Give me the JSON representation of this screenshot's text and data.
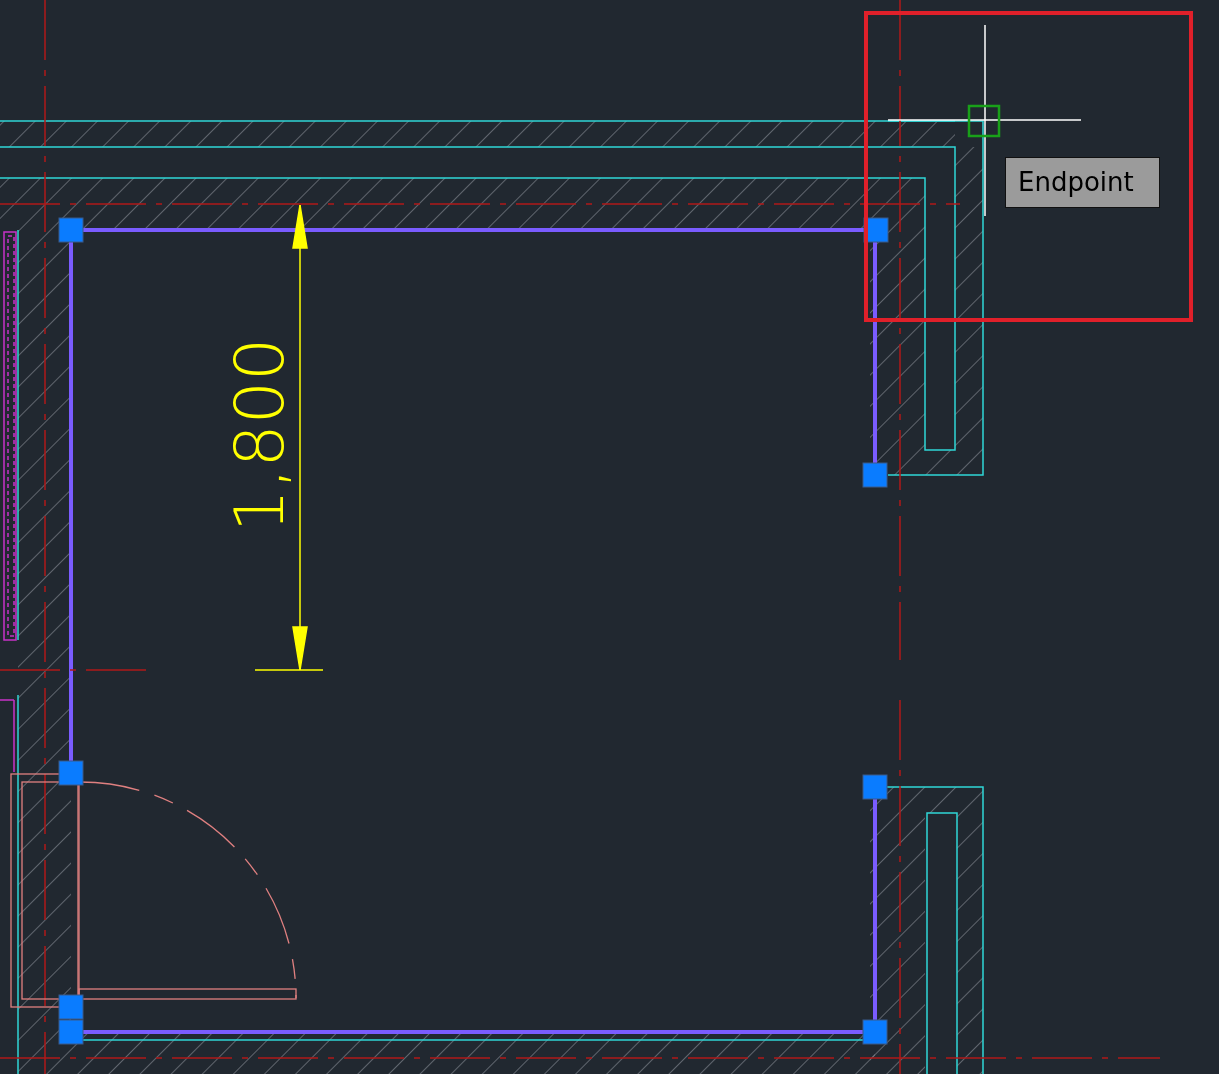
{
  "drawing": {
    "dimension": {
      "text": "1,800"
    },
    "snap_tooltip": {
      "label": "Endpoint"
    }
  }
}
